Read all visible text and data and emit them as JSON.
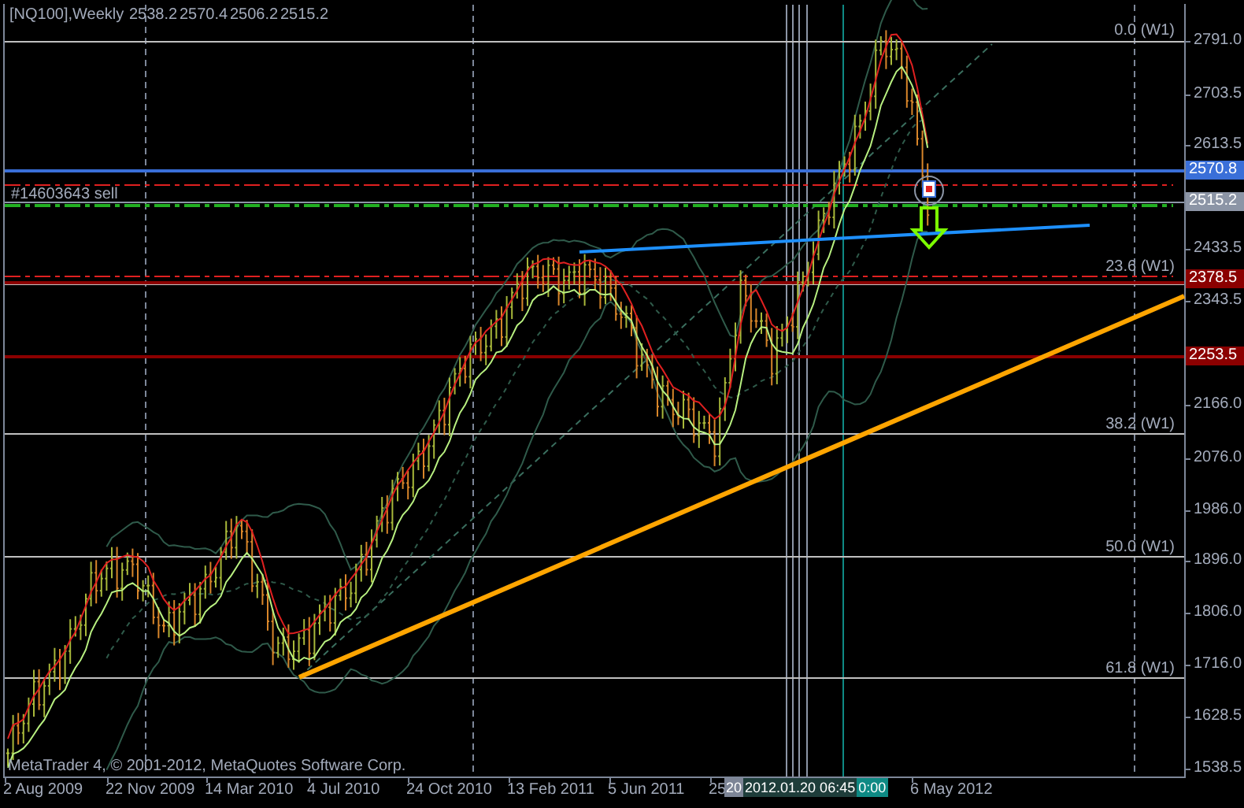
{
  "chart": {
    "title": "[NQ100],Weekly",
    "ohlc": [
      "2538.2",
      "2570.4",
      "2506.2",
      "2515.2"
    ],
    "order_label": "#14603643 sell",
    "fib_levels": [
      {
        "label": "0.0 (W1)"
      },
      {
        "label": "23.6 (W1)"
      },
      {
        "label": "38.2 (W1)"
      },
      {
        "label": "50.0 (W1)"
      },
      {
        "label": "61.8 (W1)"
      }
    ],
    "price_axis": [
      {
        "label": "2791.0",
        "kind": "tick"
      },
      {
        "label": "2703.5",
        "kind": "tick"
      },
      {
        "label": "2613.5",
        "kind": "tick"
      },
      {
        "label": "2570.8",
        "kind": "badge",
        "color": "#3a6fd8"
      },
      {
        "label": "2515.2",
        "kind": "badge",
        "color": "#8c95a6"
      },
      {
        "label": "2433.5",
        "kind": "tick"
      },
      {
        "label": "2378.5",
        "kind": "badge",
        "color": "#8b0000"
      },
      {
        "label": "2343.5",
        "kind": "tick"
      },
      {
        "label": "2253.5",
        "kind": "badge",
        "color": "#8b0000"
      },
      {
        "label": "2166.0",
        "kind": "tick"
      },
      {
        "label": "2076.0",
        "kind": "tick"
      },
      {
        "label": "1986.0",
        "kind": "tick"
      },
      {
        "label": "1896.0",
        "kind": "tick"
      },
      {
        "label": "1806.0",
        "kind": "tick"
      },
      {
        "label": "1716.0",
        "kind": "tick"
      },
      {
        "label": "1628.5",
        "kind": "tick"
      },
      {
        "label": "1538.5",
        "kind": "tick"
      }
    ],
    "time_axis": [
      "2 Aug 2009",
      "22 Nov 2009",
      "14 Mar 2010",
      "4 Jul 2010",
      "24 Oct 2010",
      "13 Feb 2011",
      "5 Jun 2011",
      "25",
      "6 May 2012"
    ],
    "time_badges": [
      {
        "label": "20",
        "color": "#7d8596"
      },
      {
        "label": "2012.01.20 06:45",
        "color": "#1e3d3a"
      },
      {
        "label": "0:00",
        "color": "#0e8a84"
      }
    ],
    "copyright": "MetaTrader 4, © 2001-2012, MetaQuotes Software Corp."
  }
}
